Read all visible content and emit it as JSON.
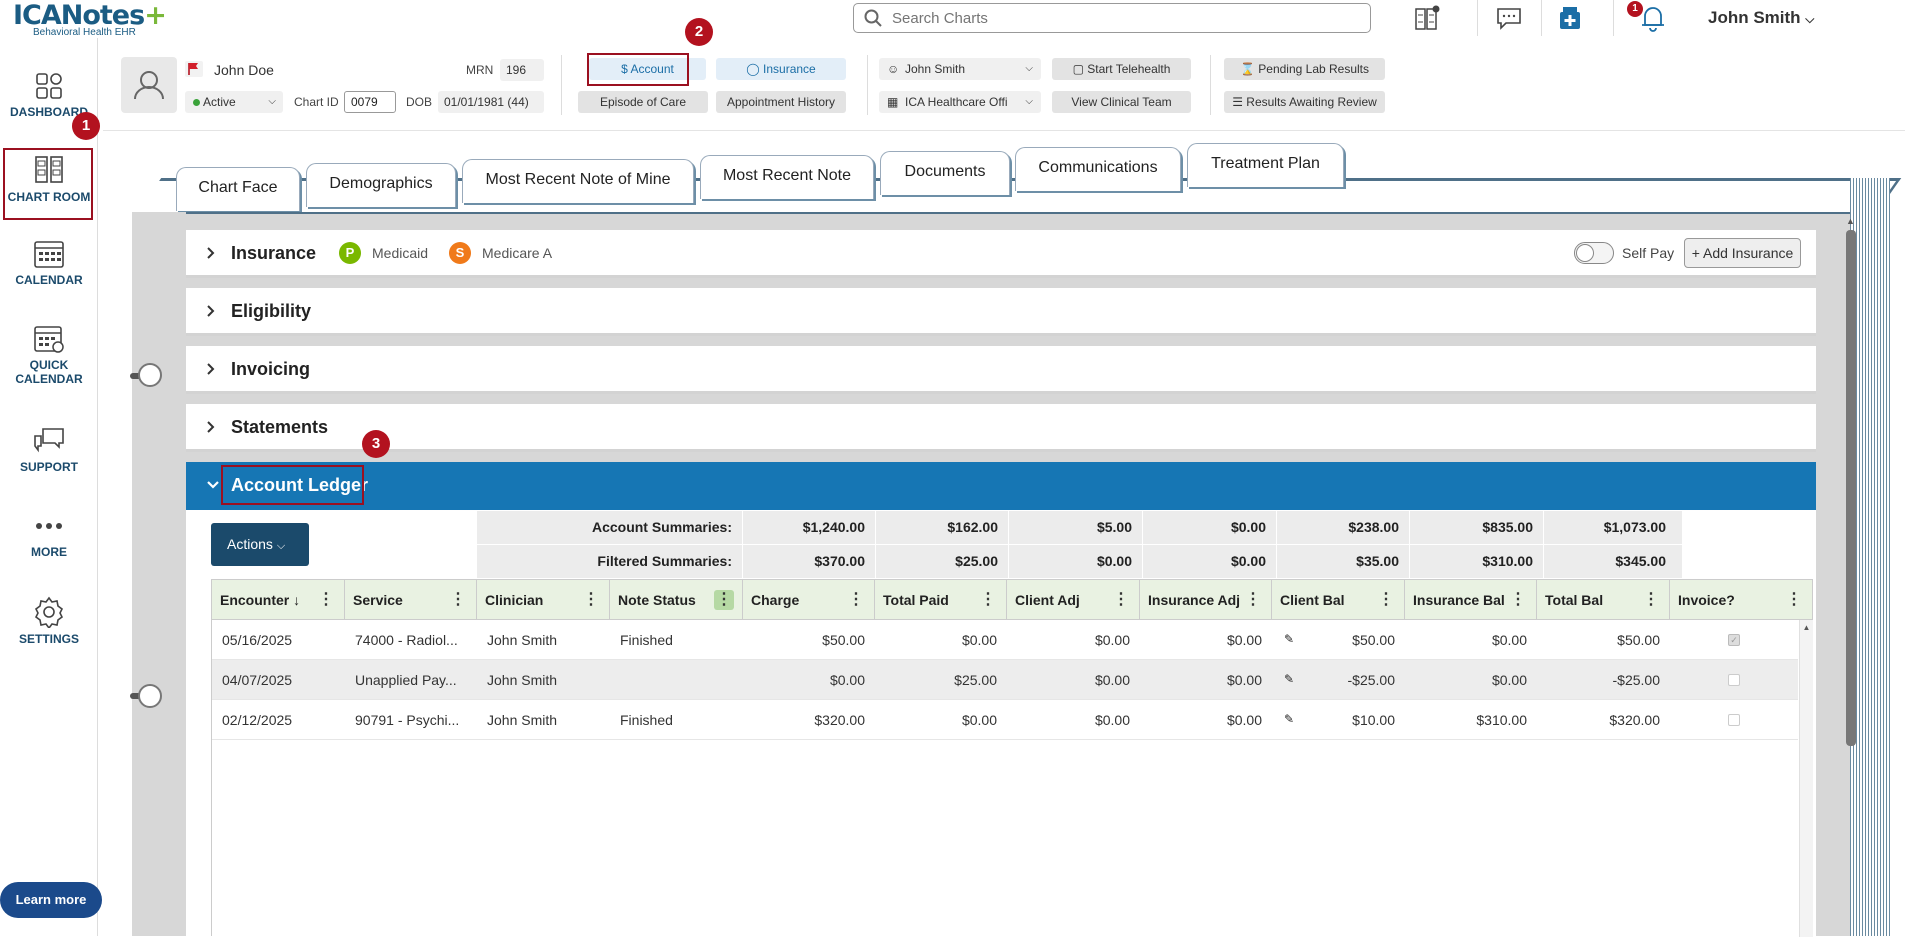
{
  "app": {
    "logo_text": "ICANotes",
    "logo_plus": "+",
    "logo_sub": "Behavioral Health EHR"
  },
  "topbar": {
    "search_placeholder": "Search Charts",
    "user_name": "John Smith",
    "notification_count": "1"
  },
  "sidebar": {
    "items": [
      {
        "label": "DASHBOARD",
        "icon": "dashboard-icon"
      },
      {
        "label": "CHART ROOM",
        "icon": "chart-room-icon"
      },
      {
        "label": "CALENDAR",
        "icon": "calendar-icon"
      },
      {
        "label": "QUICK\nCALENDAR",
        "label1": "QUICK",
        "label2": "CALENDAR",
        "icon": "quick-calendar-icon"
      },
      {
        "label": "SUPPORT",
        "icon": "support-icon"
      },
      {
        "label": "MORE",
        "icon": "more-icon"
      },
      {
        "label": "SETTINGS",
        "icon": "gear-icon"
      }
    ],
    "learn_more": "Learn more"
  },
  "annotations": [
    "1",
    "2",
    "3"
  ],
  "patient": {
    "name": "John Doe",
    "status": "Active",
    "mrn_label": "MRN",
    "mrn": "196",
    "chart_id_label": "Chart ID",
    "chart_id": "0079",
    "dob_label": "DOB",
    "dob": "01/01/1981 (44)"
  },
  "header_buttons": {
    "account": "Account",
    "insurance": "Insurance",
    "episode": "Episode of Care",
    "appt_history": "Appointment History",
    "clinician": "John Smith",
    "office": "ICA Healthcare Offi",
    "telehealth": "Start Telehealth",
    "clinical_team": "View Clinical Team",
    "pending_lab": "Pending Lab Results",
    "results_review": "Results Awaiting Review"
  },
  "tabs": [
    "Chart Face",
    "Demographics",
    "Most Recent Note of Mine",
    "Most Recent Note",
    "Documents",
    "Communications",
    "Treatment Plan"
  ],
  "sections": {
    "insurance": "Insurance",
    "insurance_primary_badge": "P",
    "insurance_primary": "Medicaid",
    "insurance_secondary_badge": "S",
    "insurance_secondary": "Medicare A",
    "self_pay": "Self Pay",
    "add_insurance": "+ Add Insurance",
    "eligibility": "Eligibility",
    "invoicing": "Invoicing",
    "statements": "Statements",
    "account_ledger": "Account Ledger"
  },
  "ledger": {
    "actions_label": "Actions",
    "account_summaries_label": "Account Summaries:",
    "filtered_summaries_label": "Filtered Summaries:",
    "account_summaries": [
      "$1,240.00",
      "$162.00",
      "$5.00",
      "$0.00",
      "$238.00",
      "$835.00",
      "$1,073.00"
    ],
    "filtered_summaries": [
      "$370.00",
      "$25.00",
      "$0.00",
      "$0.00",
      "$35.00",
      "$310.00",
      "$345.00"
    ],
    "columns": [
      "Encounter",
      "Service",
      "Clinician",
      "Note Status",
      "Charge",
      "Total Paid",
      "Client Adj",
      "Insurance Adj",
      "Client Bal",
      "Insurance Bal",
      "Total Bal",
      "Invoice?"
    ],
    "rows": [
      {
        "encounter": "05/16/2025",
        "service": "74000 - Radiol...",
        "clinician": "John Smith",
        "note_status": "Finished",
        "charge": "$50.00",
        "total_paid": "$0.00",
        "client_adj": "$0.00",
        "insurance_adj": "$0.00",
        "client_bal": "$50.00",
        "insurance_bal": "$0.00",
        "total_bal": "$50.00",
        "invoice": true
      },
      {
        "encounter": "04/07/2025",
        "service": "Unapplied Pay...",
        "clinician": "John Smith",
        "note_status": "",
        "charge": "$0.00",
        "total_paid": "$25.00",
        "client_adj": "$0.00",
        "insurance_adj": "$0.00",
        "client_bal": "-$25.00",
        "insurance_bal": "$0.00",
        "total_bal": "-$25.00",
        "invoice": false
      },
      {
        "encounter": "02/12/2025",
        "service": "90791 - Psychi...",
        "clinician": "John Smith",
        "note_status": "Finished",
        "charge": "$320.00",
        "total_paid": "$0.00",
        "client_adj": "$0.00",
        "insurance_adj": "$0.00",
        "client_bal": "$10.00",
        "insurance_bal": "$310.00",
        "total_bal": "$320.00",
        "invoice": false
      }
    ]
  },
  "colors": {
    "brand": "#1b5c83",
    "accent_blue": "#1676b4",
    "annotation_red": "#b3121f",
    "header_green": "#e9f2e2",
    "primary_badge": "#7ab800",
    "secondary_badge": "#f07a1a"
  }
}
